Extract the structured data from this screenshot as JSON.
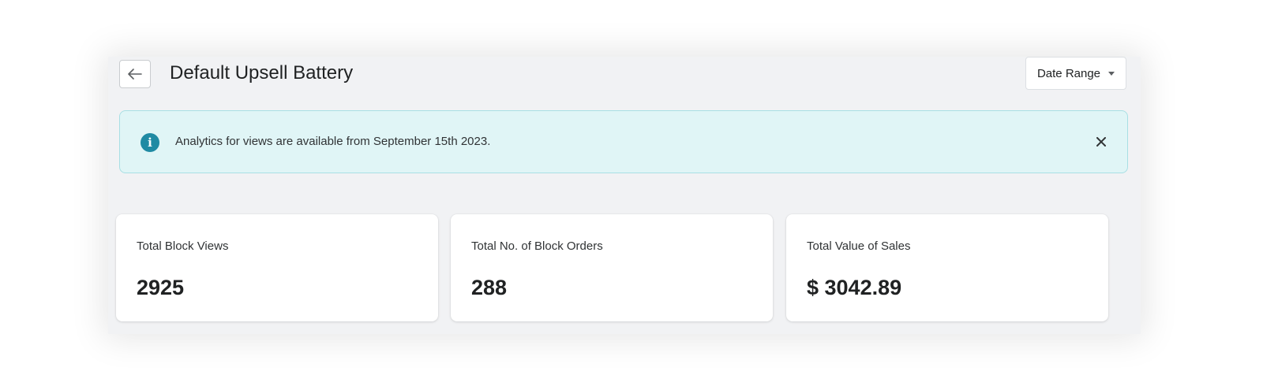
{
  "header": {
    "title": "Default Upsell Battery",
    "back_icon": "arrow-left-icon",
    "date_range_label": "Date Range",
    "date_range_icon": "caret-down-icon"
  },
  "banner": {
    "icon": "info-icon",
    "text": "Analytics for views are available from September 15th 2023.",
    "close_icon": "close-icon",
    "colors": {
      "background": "#e0f5f6",
      "icon": "#1f8aa3"
    }
  },
  "stats": [
    {
      "label": "Total Block Views",
      "value": "2925"
    },
    {
      "label": "Total No. of Block Orders",
      "value": "288"
    },
    {
      "label": "Total Value of Sales",
      "value": "$ 3042.89"
    }
  ]
}
